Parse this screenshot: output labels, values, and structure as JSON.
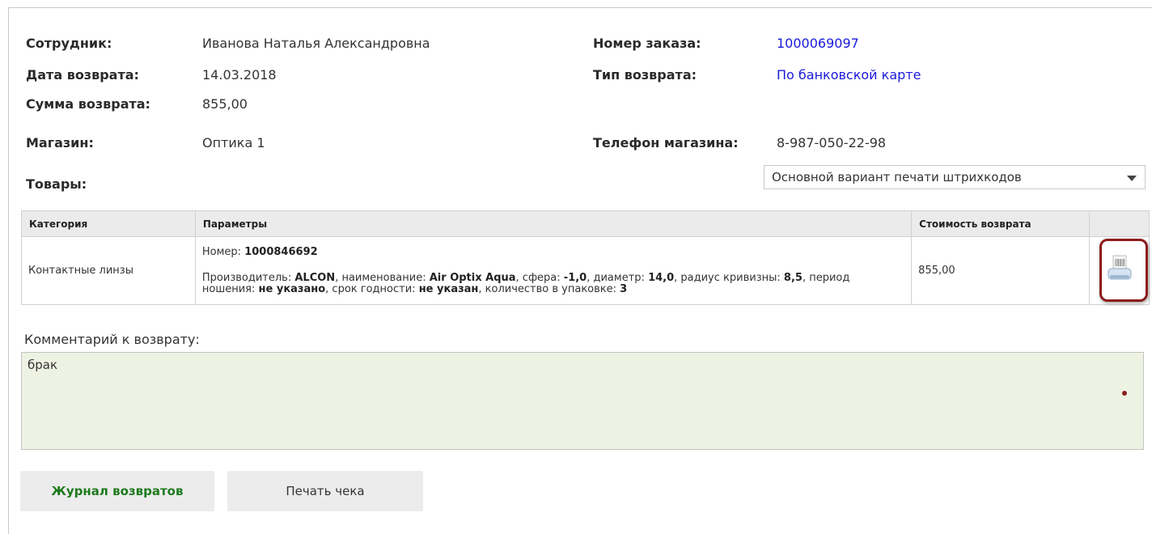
{
  "info": {
    "employee_label": "Сотрудник:",
    "employee_value": "Иванова Наталья Александровна",
    "return_date_label": "Дата возврата:",
    "return_date_value": "14.03.2018",
    "return_sum_label": "Сумма возврата:",
    "return_sum_value": "855,00",
    "store_label": "Магазин:",
    "store_value": "Оптика 1",
    "goods_label": "Товары:",
    "order_number_label": "Номер заказа:",
    "order_number_value": "1000069097",
    "return_type_label": "Тип возврата:",
    "return_type_value": "По банковской карте",
    "store_phone_label": "Телефон магазина:",
    "store_phone_value": "8-987-050-22-98"
  },
  "barcode_select": {
    "selected": "Основной вариант печати штрихкодов"
  },
  "table": {
    "headers": [
      "Категория",
      "Параметры",
      "Стоимость возврата",
      ""
    ],
    "row": {
      "category": "Контактные линзы",
      "number_label": "Номер:",
      "number_value": "1000846692",
      "manufacturer_label": "Производитель:",
      "manufacturer_value": "ALCON",
      "name_label": ", наименование:",
      "name_value": "Air Optix Aqua",
      "sphere_label": ", сфера:",
      "sphere_value": "-1,0",
      "diameter_label": ", диаметр:",
      "diameter_value": "14,0",
      "radius_label": ", радиус кривизны:",
      "radius_value": "8,5",
      "period_label": ", период ношения:",
      "period_value": "не указано",
      "expiry_label": ", срок годности:",
      "expiry_value": "не указан",
      "quantity_label": ", количество в упаковке:",
      "quantity_value": "3",
      "cost": "855,00",
      "print_icon": "barcode-printer-icon"
    }
  },
  "comment": {
    "label": "Комментарий к возврату:",
    "value": "брак"
  },
  "buttons": {
    "journal": "Журнал возвратов",
    "print_receipt": "Печать чека"
  },
  "colors": {
    "link": "#1a1adb",
    "highlight": "#8b1c1c",
    "journal_button_text": "#1e7a1e",
    "comment_bg": "#eef2e3"
  }
}
